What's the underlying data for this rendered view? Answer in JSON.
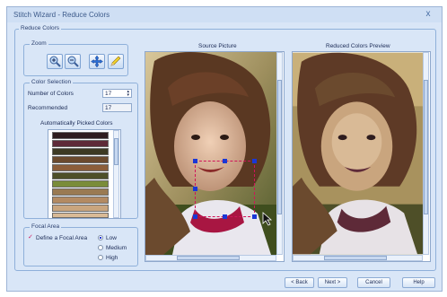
{
  "window": {
    "title": "Stitch Wizard - Reduce Colors",
    "close_glyph": "x"
  },
  "reduce_colors": {
    "label": "Reduce Colors"
  },
  "zoom": {
    "label": "Zoom",
    "tools": [
      "zoom-in-icon",
      "zoom-out-icon",
      "pan-icon",
      "pencil-icon"
    ]
  },
  "color_selection": {
    "label": "Color Selection",
    "number_label": "Number of Colors",
    "number_value": "17",
    "recommended_label": "Recommended",
    "recommended_value": "17",
    "auto_label": "Automatically Picked Colors",
    "swatches": [
      "#2e1c1e",
      "#5e2a38",
      "#3d3a24",
      "#6b4a2e",
      "#8c5e3a",
      "#4e4f28",
      "#7a8c3a",
      "#9a7a52",
      "#b38a62",
      "#c9a57e",
      "#d9ba96"
    ]
  },
  "focal_area": {
    "label": "Focal Area",
    "define_label": "Define a Focal Area",
    "define_check": "✓",
    "options": [
      "Low",
      "Medium",
      "High"
    ],
    "selected": "Low"
  },
  "source": {
    "label": "Source Picture"
  },
  "preview": {
    "label": "Reduced Colors Preview"
  },
  "buttons": {
    "back": "< Back",
    "next": "Next >",
    "cancel": "Cancel",
    "help": "Help"
  },
  "colors": {
    "accent": "#1a37d6",
    "selection": "#d0145a",
    "window_bg": "#d9e6f7"
  }
}
